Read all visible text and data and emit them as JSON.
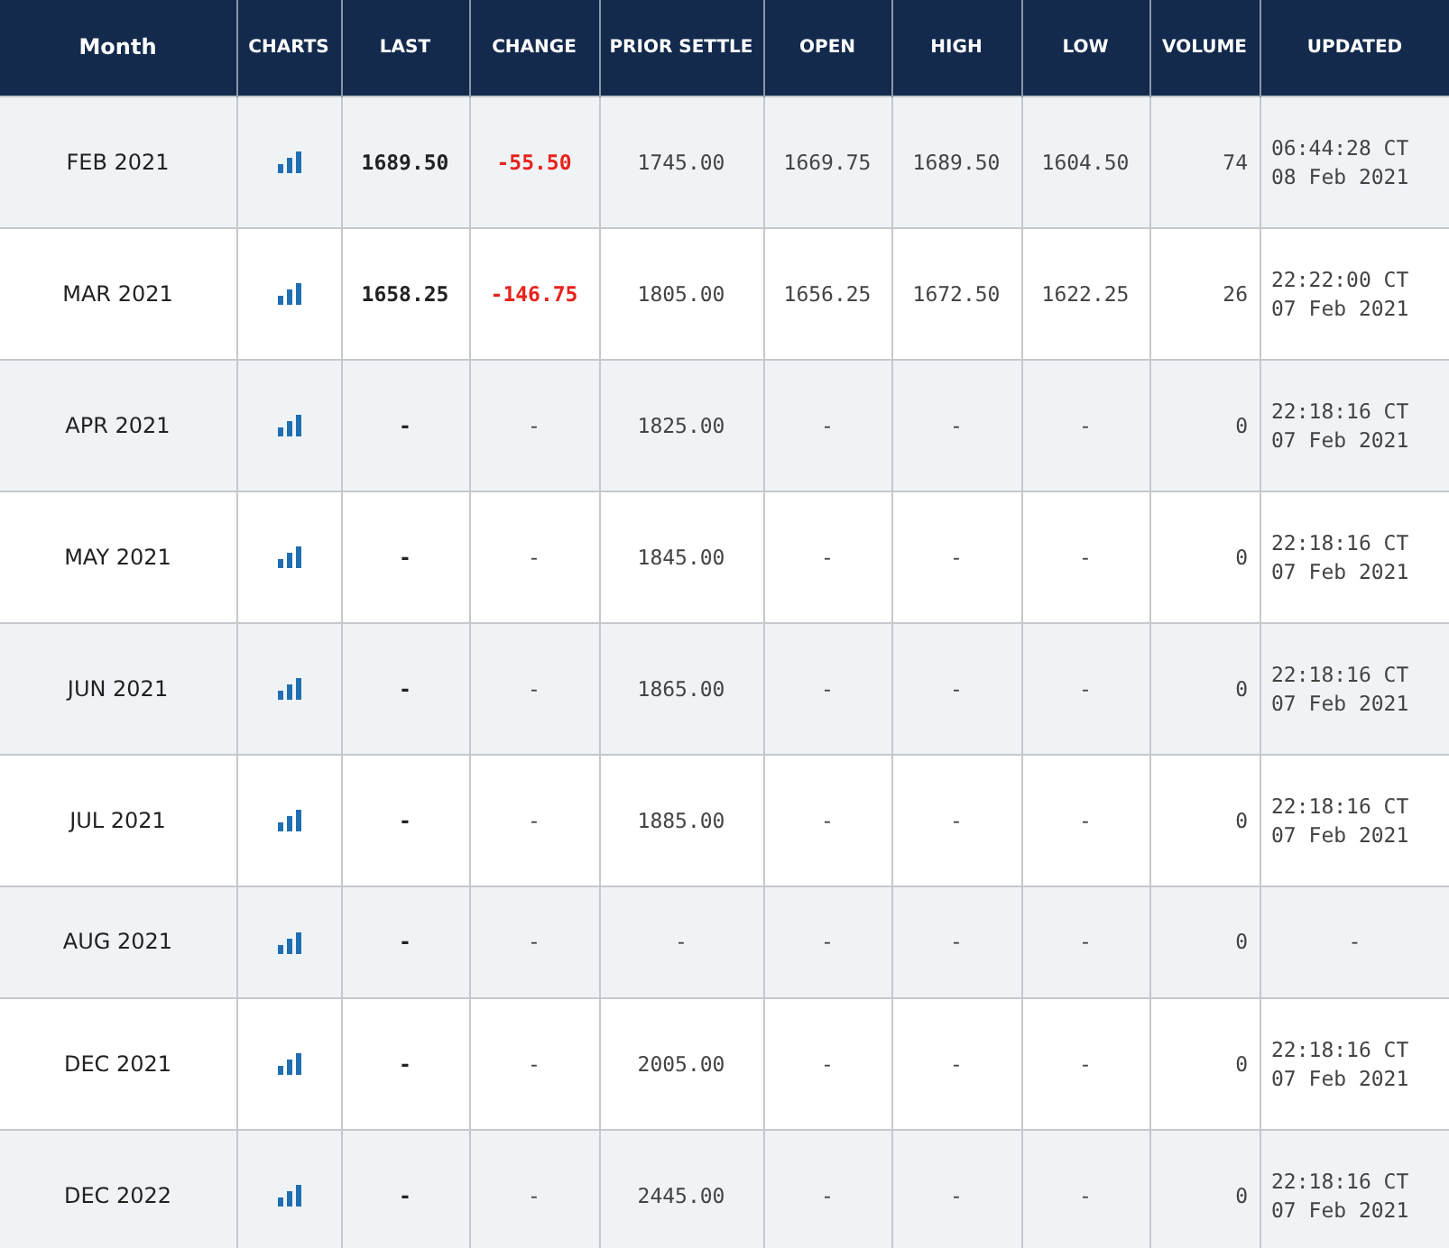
{
  "table": {
    "columns": [
      "Month",
      "CHARTS",
      "LAST",
      "CHANGE",
      "PRIOR SETTLE",
      "OPEN",
      "HIGH",
      "LOW",
      "VOLUME",
      "UPDATED"
    ],
    "rows": [
      {
        "month": "FEB 2021",
        "last": "1689.50",
        "change": "-55.50",
        "change_down": true,
        "prior_settle": "1745.00",
        "open": "1669.75",
        "high": "1689.50",
        "low": "1604.50",
        "volume": "74",
        "updated": [
          "06:44:28 CT",
          "08 Feb 2021"
        ]
      },
      {
        "month": "MAR 2021",
        "last": "1658.25",
        "change": "-146.75",
        "change_down": true,
        "prior_settle": "1805.00",
        "open": "1656.25",
        "high": "1672.50",
        "low": "1622.25",
        "volume": "26",
        "updated": [
          "22:22:00 CT",
          "07 Feb 2021"
        ]
      },
      {
        "month": "APR 2021",
        "last": "-",
        "change": "-",
        "change_down": false,
        "prior_settle": "1825.00",
        "open": "-",
        "high": "-",
        "low": "-",
        "volume": "0",
        "updated": [
          "22:18:16 CT",
          "07 Feb 2021"
        ]
      },
      {
        "month": "MAY 2021",
        "last": "-",
        "change": "-",
        "change_down": false,
        "prior_settle": "1845.00",
        "open": "-",
        "high": "-",
        "low": "-",
        "volume": "0",
        "updated": [
          "22:18:16 CT",
          "07 Feb 2021"
        ]
      },
      {
        "month": "JUN 2021",
        "last": "-",
        "change": "-",
        "change_down": false,
        "prior_settle": "1865.00",
        "open": "-",
        "high": "-",
        "low": "-",
        "volume": "0",
        "updated": [
          "22:18:16 CT",
          "07 Feb 2021"
        ]
      },
      {
        "month": "JUL 2021",
        "last": "-",
        "change": "-",
        "change_down": false,
        "prior_settle": "1885.00",
        "open": "-",
        "high": "-",
        "low": "-",
        "volume": "0",
        "updated": [
          "22:18:16 CT",
          "07 Feb 2021"
        ]
      },
      {
        "month": "AUG 2021",
        "last": "-",
        "change": "-",
        "change_down": false,
        "prior_settle": "-",
        "open": "-",
        "high": "-",
        "low": "-",
        "volume": "0",
        "updated": [
          "-"
        ]
      },
      {
        "month": "DEC 2021",
        "last": "-",
        "change": "-",
        "change_down": false,
        "prior_settle": "2005.00",
        "open": "-",
        "high": "-",
        "low": "-",
        "volume": "0",
        "updated": [
          "22:18:16 CT",
          "07 Feb 2021"
        ]
      },
      {
        "month": "DEC 2022",
        "last": "-",
        "change": "-",
        "change_down": false,
        "prior_settle": "2445.00",
        "open": "-",
        "high": "-",
        "low": "-",
        "volume": "0",
        "updated": [
          "22:18:16 CT",
          "07 Feb 2021"
        ]
      }
    ]
  }
}
